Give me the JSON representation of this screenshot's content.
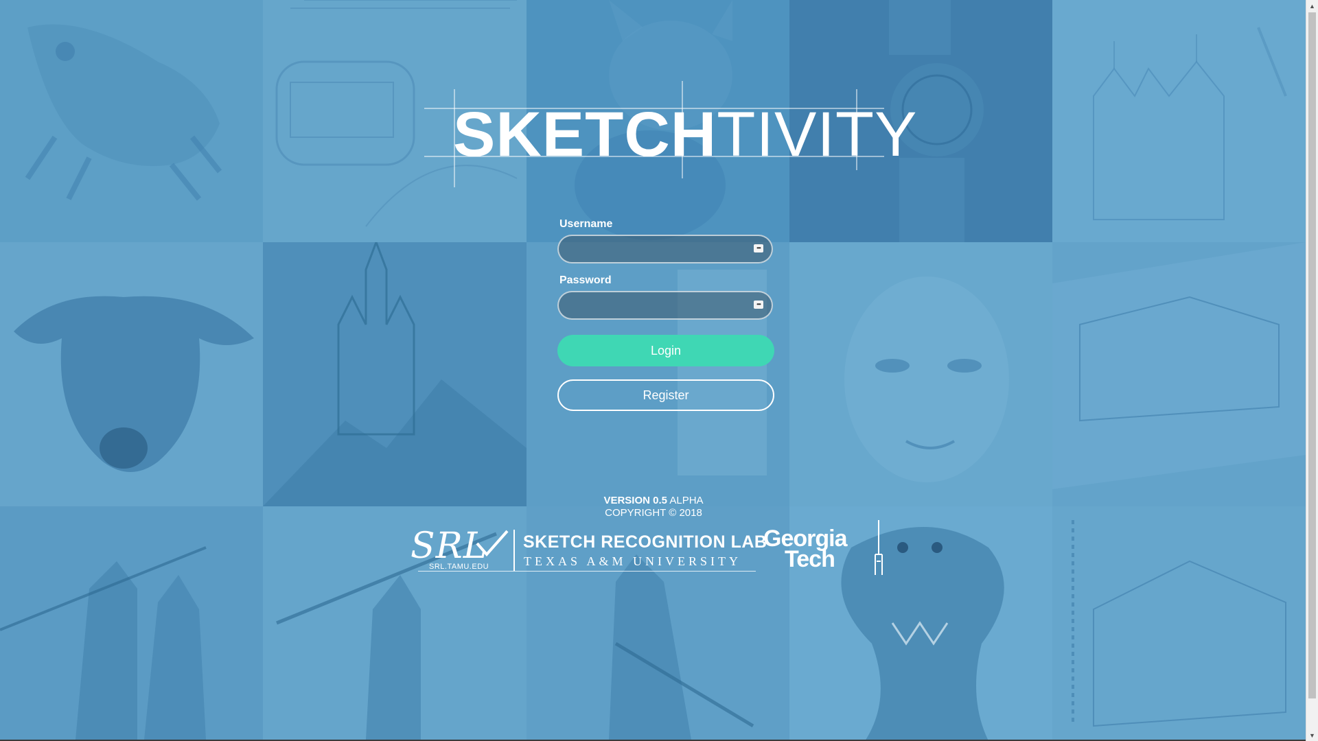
{
  "app": {
    "logo_bold": "SKETCH",
    "logo_thin": "TIVITY"
  },
  "login_form": {
    "username_label": "Username",
    "username_value": "",
    "password_label": "Password",
    "password_value": "",
    "input_icon_glyph": "•••",
    "login_label": "Login",
    "register_label": "Register"
  },
  "footer": {
    "version_label": "VERSION",
    "version_number": "0.5",
    "version_stage": "ALPHA",
    "copyright": "COPYRIGHT © 2018"
  },
  "partners": {
    "srl_mark": "SRL",
    "srl_url": "SRL.TAMU.EDU",
    "lab_name": "SKETCH RECOGNITION LAB",
    "university": "TEXAS A&M UNIVERSITY",
    "gt_line1": "Georgia",
    "gt_line2": "Tech"
  },
  "background": {
    "tiles": [
      "frog-sketch",
      "machine-sketch",
      "pikachu-sketch",
      "watch-sketch",
      "cathedral-sketch",
      "dog-sketch",
      "castle-sketch",
      "drinks-sketch",
      "woman-portrait-sketch",
      "street-sketch",
      "anime-warriors-sketch",
      "anime-spear-sketch",
      "knight-sketch",
      "alien-creature-sketch",
      "town-sketch"
    ],
    "tint_color": "#5f9fc4"
  },
  "colors": {
    "accent": "#3fd7b4",
    "text": "#ffffff"
  }
}
